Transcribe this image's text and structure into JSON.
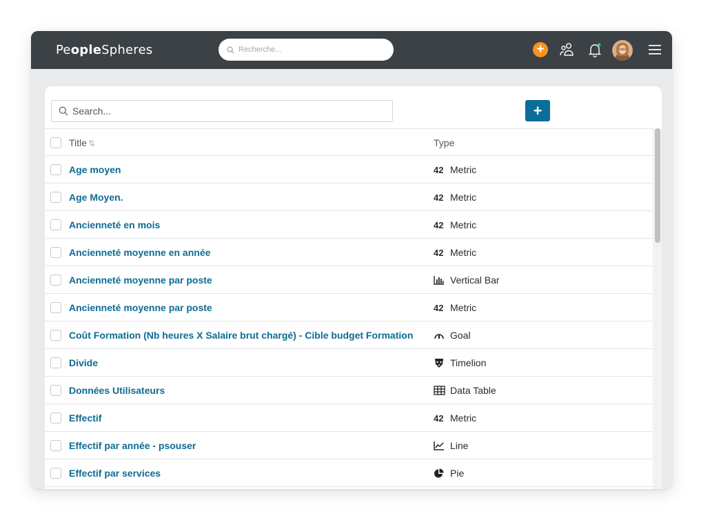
{
  "app": {
    "logo_part1": "Pe",
    "logo_part2": "ople",
    "logo_part3": "Spheres",
    "search_placeholder": "Recherche...",
    "accent_color": "#f7941d",
    "topbar_color": "#3b4145"
  },
  "toolbar": {
    "search_placeholder": "Search...",
    "add_label": "+"
  },
  "table": {
    "col_title": "Title",
    "col_type": "Type",
    "rows": [
      {
        "title": "Age moyen",
        "type": "Metric",
        "icon": "metric-icon"
      },
      {
        "title": "Age Moyen.",
        "type": "Metric",
        "icon": "metric-icon"
      },
      {
        "title": "Ancienneté en mois",
        "type": "Metric",
        "icon": "metric-icon"
      },
      {
        "title": "Ancienneté moyenne en année",
        "type": "Metric",
        "icon": "metric-icon"
      },
      {
        "title": "Ancienneté moyenne par poste",
        "type": "Vertical Bar",
        "icon": "vertical-bar-icon"
      },
      {
        "title": "Ancienneté moyenne par poste",
        "type": "Metric",
        "icon": "metric-icon"
      },
      {
        "title": "Coût Formation (Nb heures X Salaire brut chargé) - Cible budget Formation",
        "type": "Goal",
        "icon": "goal-icon"
      },
      {
        "title": "Divide",
        "type": "Timelion",
        "icon": "timelion-icon"
      },
      {
        "title": "Données Utilisateurs",
        "type": "Data Table",
        "icon": "data-table-icon"
      },
      {
        "title": "Effectif",
        "type": "Metric",
        "icon": "metric-icon"
      },
      {
        "title": "Effectif par année - psouser",
        "type": "Line",
        "icon": "line-icon"
      },
      {
        "title": "Effectif par services",
        "type": "Pie",
        "icon": "pie-icon"
      }
    ],
    "metric_glyph": "42"
  }
}
